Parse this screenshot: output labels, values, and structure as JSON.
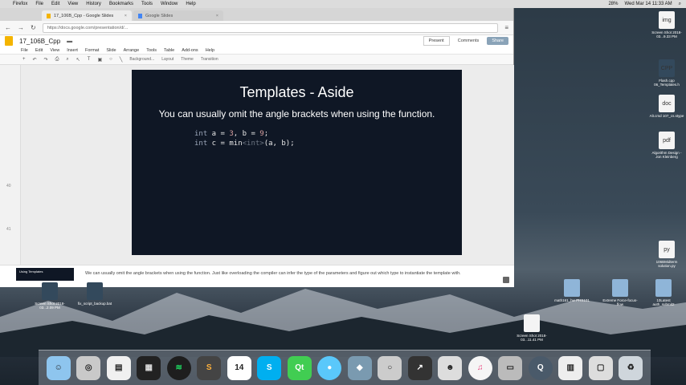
{
  "menubar": {
    "items": [
      "Firefox",
      "File",
      "Edit",
      "View",
      "History",
      "Bookmarks",
      "Tools",
      "Window",
      "Help"
    ],
    "clock": "Wed Mar 14  11:33 AM",
    "battery": "28%"
  },
  "browser": {
    "tabs": [
      {
        "label": "17_106B_Cpp - Google Slides"
      },
      {
        "label": "Google Slides"
      }
    ],
    "url": "https://docs.google.com/presentation/d/..."
  },
  "doc": {
    "title": "17_106B_Cpp",
    "menu": [
      "File",
      "Edit",
      "View",
      "Insert",
      "Format",
      "Slide",
      "Arrange",
      "Tools",
      "Table",
      "Add-ons",
      "Help"
    ],
    "present_label": "Present",
    "comments_label": "Comments",
    "share_label": "Share",
    "toolbar": [
      "Background...",
      "Layout",
      "Theme",
      "Transition"
    ]
  },
  "filmstrip": {
    "numbers": [
      "40",
      "41"
    ]
  },
  "slide": {
    "title": "Templates - Aside",
    "subtitle": "You can usually omit the angle brackets when using the function.",
    "code": {
      "line1": {
        "kw": "int",
        "rest_a": " a = ",
        "val_a": "3",
        "rest_b": ", b = ",
        "val_b": "9",
        "end": ";"
      },
      "line2": {
        "kw": "int",
        "rest": " c = min",
        "faded": "<int>",
        "end": "(a, b);"
      }
    }
  },
  "notes": {
    "thumb_title": "Using Templates",
    "text": "We can usually omit the angle brackets when using the function. Just like overloading the compiler can infer the type of the parameters and figure out which type to instantiate the template with."
  },
  "desktop_icons": [
    {
      "label": "Screen Shot 2018-03...9.33 PM",
      "glyph": "img"
    },
    {
      "label": "Flash.cpp 06_Templates.h",
      "glyph": "CPP"
    },
    {
      "label": "Alt.cmd 107_cs.stype",
      "glyph": "doc"
    },
    {
      "label": "Algorithm Design - Jon Kleinberg",
      "glyph": "pdf"
    },
    {
      "label": "106BMidterm solution.py",
      "glyph": "py"
    },
    {
      "label": "math161_hw PHS101",
      "glyph": ""
    },
    {
      "label": "Extreme Force-focus-flow",
      "glyph": ""
    },
    {
      "label": "10Latest auth_submit2",
      "glyph": ""
    },
    {
      "label": "Screen Shot 2018-03...2.09 PM",
      "glyph": ""
    },
    {
      "label": "fix_script_backup.bat",
      "glyph": ""
    },
    {
      "label": "Screen Shot 2018-03...11.41 PM",
      "glyph": ""
    }
  ],
  "dock": [
    "☺",
    "◎",
    "▤",
    "▦",
    "≋",
    "S",
    "14",
    "S",
    "Qt",
    "●",
    "◆",
    "○",
    "↗",
    "☻",
    "♫",
    "▭",
    "Q",
    "▥",
    "▢",
    "♻"
  ]
}
